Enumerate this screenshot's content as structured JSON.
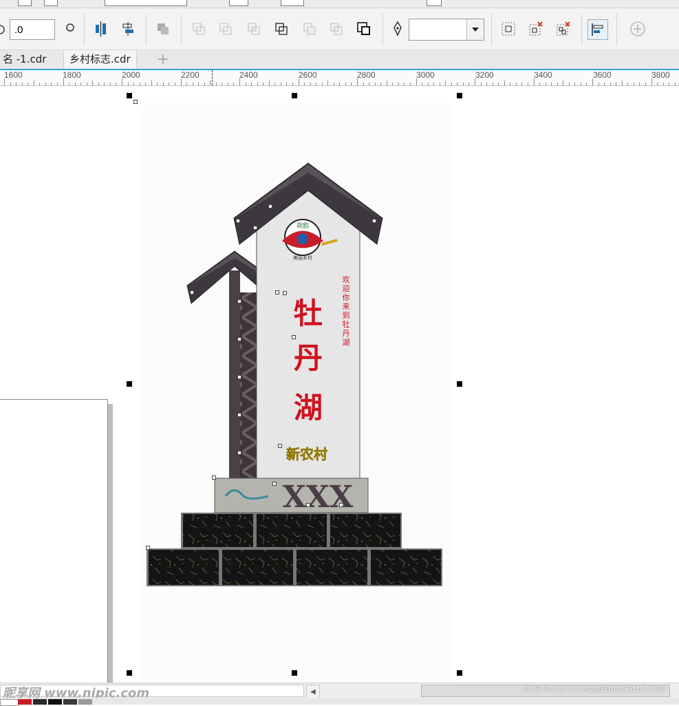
{
  "tabs": [
    {
      "label": "名 -1.cdr"
    },
    {
      "label": "乡村标志.cdr"
    }
  ],
  "tab_add_label": "+",
  "property_bar": {
    "angle_value": ".0",
    "outline_width_value": ""
  },
  "ruler_labels": [
    "1600",
    "1800",
    "2000",
    "2200",
    "2400",
    "2600",
    "2800",
    "3000",
    "3200",
    "3400",
    "3600",
    "3800"
  ],
  "sign": {
    "title_chars": [
      "牡",
      "丹",
      "湖"
    ],
    "subtitle": "新农村",
    "side_text_chars": [
      "欢",
      "迎",
      "你",
      "来",
      "到",
      "牡",
      "丹",
      "湖"
    ],
    "plaque_text": "XXX",
    "logo_top": "荷韵",
    "logo_bottom": "美丽乡村"
  },
  "watermark": "昵享网 www.nipic.com",
  "image_id": "ID:25474147 NO:20220510195911873106",
  "colors": {
    "roof": "#3d3840",
    "pillar": "#4a4046",
    "sign_face": "#e6e6e6",
    "title_red": "#d0121f",
    "subtitle_yellow": "#e8c800",
    "stone": "#141414",
    "selection_blue": "#3aa0d8",
    "palette": [
      "#c81c2a",
      "#2a2a2a",
      "#111111",
      "#3a3a3a",
      "#9a9a9a"
    ]
  },
  "icons": {
    "align": "align-center-icon",
    "distribute": "distribute-icon",
    "weld": "weld-icon",
    "trim": "trim-icon",
    "intersect": "intersect-icon",
    "simplify": "simplify-icon",
    "front_minus_back": "front-minus-back-icon",
    "back_minus_front": "back-minus-front-icon",
    "boundary": "boundary-icon",
    "pen": "pen-nib-icon",
    "group": "group-icon",
    "ungroup": "ungroup-icon",
    "ungroup_all": "ungroup-all-icon",
    "align_panel": "align-panel-icon",
    "add": "add-icon"
  }
}
